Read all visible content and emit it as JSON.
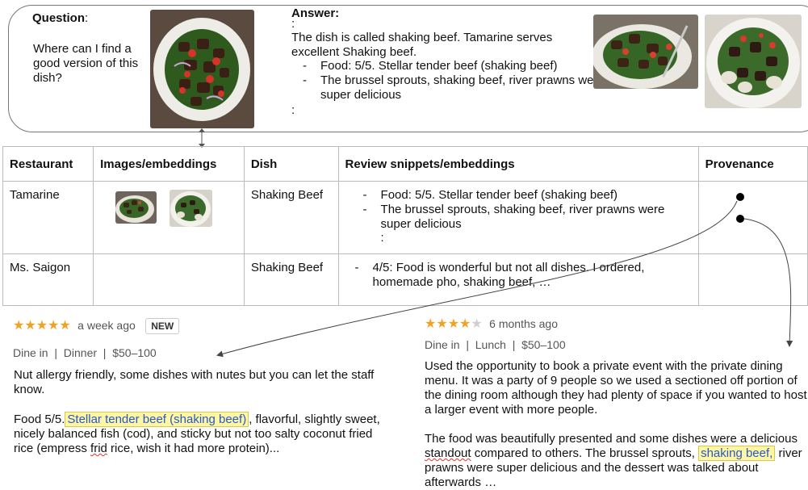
{
  "question": {
    "label": "Question",
    "text": "Where can I find a good version of this dish?"
  },
  "answer": {
    "label": "Answer:",
    "dots": ":",
    "text": "The dish is called shaking beef. Tamarine serves excellent Shaking beef.",
    "bullets": [
      "Food: 5/5. Stellar tender beef (shaking beef)",
      "The brussel sprouts, shaking beef, river prawns were super delicious"
    ]
  },
  "table": {
    "headers": [
      "Restaurant",
      "Images/embeddings",
      "Dish",
      "Review snippets/embeddings",
      "Provenance"
    ],
    "rows": [
      {
        "restaurant": "Tamarine",
        "dish": "Shaking Beef",
        "snippets": [
          "Food: 5/5. Stellar tender beef (shaking beef)",
          "The brussel sprouts, shaking beef, river prawns were super delicious"
        ],
        "dots": ":"
      },
      {
        "restaurant": "Ms. Saigon",
        "dish": "Shaking Beef",
        "snippets": [
          "4/5: Food is wonderful but not all dishes. I ordered, homemade pho, shaking beef, …"
        ]
      }
    ]
  },
  "review1": {
    "stars": "★★★★★",
    "when": "a week ago",
    "badge": "NEW",
    "meta": "Dine in  |  Dinner  |  $50–100",
    "p1": "Nut allergy friendly, some dishes with nutes but you can let the staff know.",
    "p2_pre": "Food 5/5.",
    "p2_hl": "Stellar tender beef (shaking beef)",
    "p2_post1": ", flavorful, slightly sweet, nicely balanced fish (cod), and sticky but not too salty coconut fried rice (empress ",
    "p2_frid": "frid",
    "p2_post2": " rice, wish it had more protein)..."
  },
  "review2": {
    "stars_on": "★★★★",
    "stars_off": "★",
    "when": "6 months ago",
    "meta": "Dine in  |  Lunch  |  $50–100",
    "p1": "Used the opportunity to book a private event with the private dining menu. It was a party of 9 people so we used a sectioned off portion of the dining room although they had plenty of space if you wanted to host a larger event with more people.",
    "p2_a": "The food was beautifully presented and some dishes were a delicious ",
    "p2_standout": "standout",
    "p2_b": " compared to others. The brussel sprouts,",
    "p2_hl": "shaking beef,",
    "p2_c": " river prawns were super delicious and the dessert was talked about afterwards …"
  }
}
